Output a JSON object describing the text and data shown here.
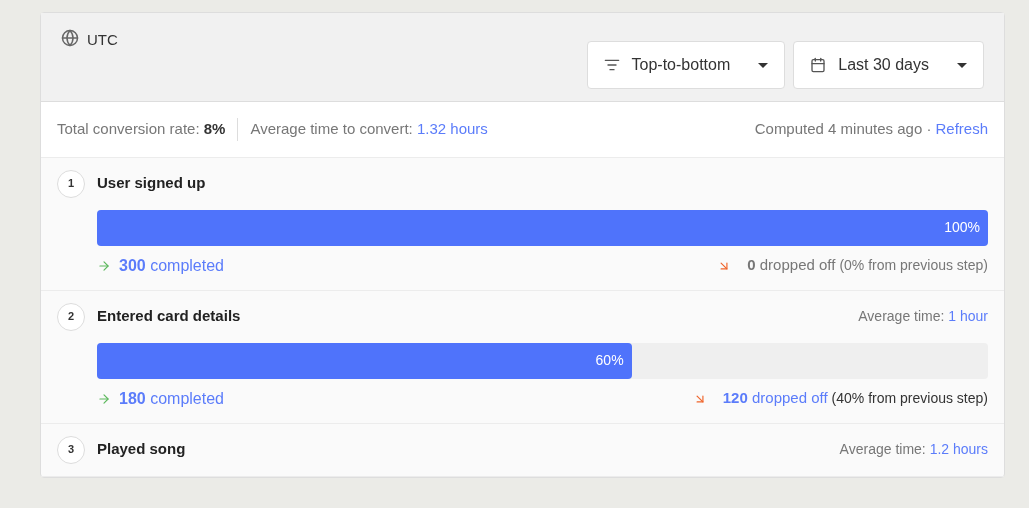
{
  "header": {
    "timezone": "UTC",
    "order_select": "Top-to-bottom",
    "date_select": "Last 30 days"
  },
  "summary": {
    "conversion_label": "Total conversion rate:",
    "conversion_value": "8%",
    "avg_label": "Average time to convert:",
    "avg_value": "1.32 hours",
    "computed": "Computed 4 minutes ago ·",
    "refresh": "Refresh"
  },
  "steps": [
    {
      "number": "1",
      "title": "User signed up",
      "level": 1,
      "percent": "100%",
      "completed": "**300** completed",
      "dropped": "**0** dropped off",
      "dropped_highlight": false,
      "dropped_note": "(0% from previous step)"
    },
    {
      "number": "2",
      "title": "Entered card details",
      "avg_label": "Average time:",
      "avg_value": "1 hour",
      "level": 0.6,
      "percent": "60%",
      "completed": "**180** completed",
      "dropped": "**120** dropped off",
      "dropped_highlight": true,
      "dropped_note": "(40% from previous step)"
    },
    {
      "number": "3",
      "title": "Played song",
      "avg_label": "Average time:",
      "avg_value": "1.2 hours"
    }
  ]
}
